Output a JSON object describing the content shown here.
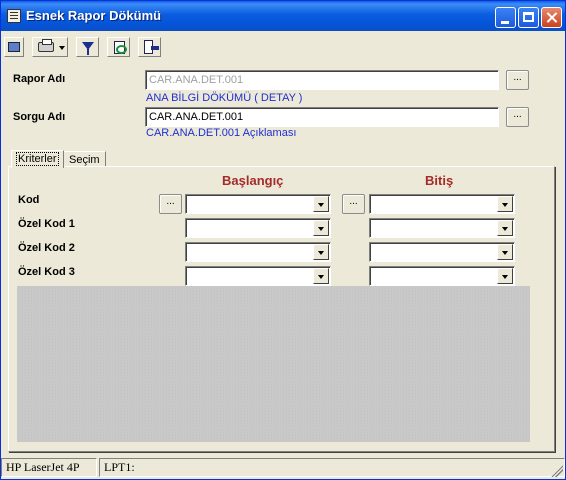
{
  "window": {
    "title": "Esnek Rapor Dökümü"
  },
  "toolbar": {
    "buttons": [
      {
        "icon": "print-preview-icon"
      },
      {
        "icon": "printer-icon"
      },
      {
        "icon": "filter-icon"
      },
      {
        "icon": "refresh-icon"
      },
      {
        "icon": "exit-icon"
      }
    ]
  },
  "form": {
    "rapor_label": "Rapor Adı",
    "rapor_value": "CAR.ANA.DET.001",
    "rapor_desc": "ANA BİLGİ DÖKÜMÜ ( DETAY )",
    "sorgu_label": "Sorgu Adı",
    "sorgu_value": "CAR.ANA.DET.001",
    "sorgu_desc": "CAR.ANA.DET.001 Açıklaması",
    "ellipsis": "..."
  },
  "tabs": [
    {
      "label": "Kriterler",
      "active": true
    },
    {
      "label": "Seçim",
      "active": false
    }
  ],
  "criteria": {
    "start_header": "Başlangıç",
    "end_header": "Bitiş",
    "rows": [
      {
        "label": "Kod",
        "start": "",
        "end": ""
      },
      {
        "label": "Özel Kod 1",
        "start": "",
        "end": ""
      },
      {
        "label": "Özel Kod 2",
        "start": "",
        "end": ""
      },
      {
        "label": "Özel Kod 3",
        "start": "",
        "end": ""
      }
    ]
  },
  "status": {
    "printer": "HP LaserJet 4P",
    "port": "LPT1:"
  },
  "colors": {
    "titlebar": "#0a5ce0",
    "header_text": "#a52a2a",
    "description_text": "#1f2fd0",
    "window_bg": "#ece9d8"
  }
}
